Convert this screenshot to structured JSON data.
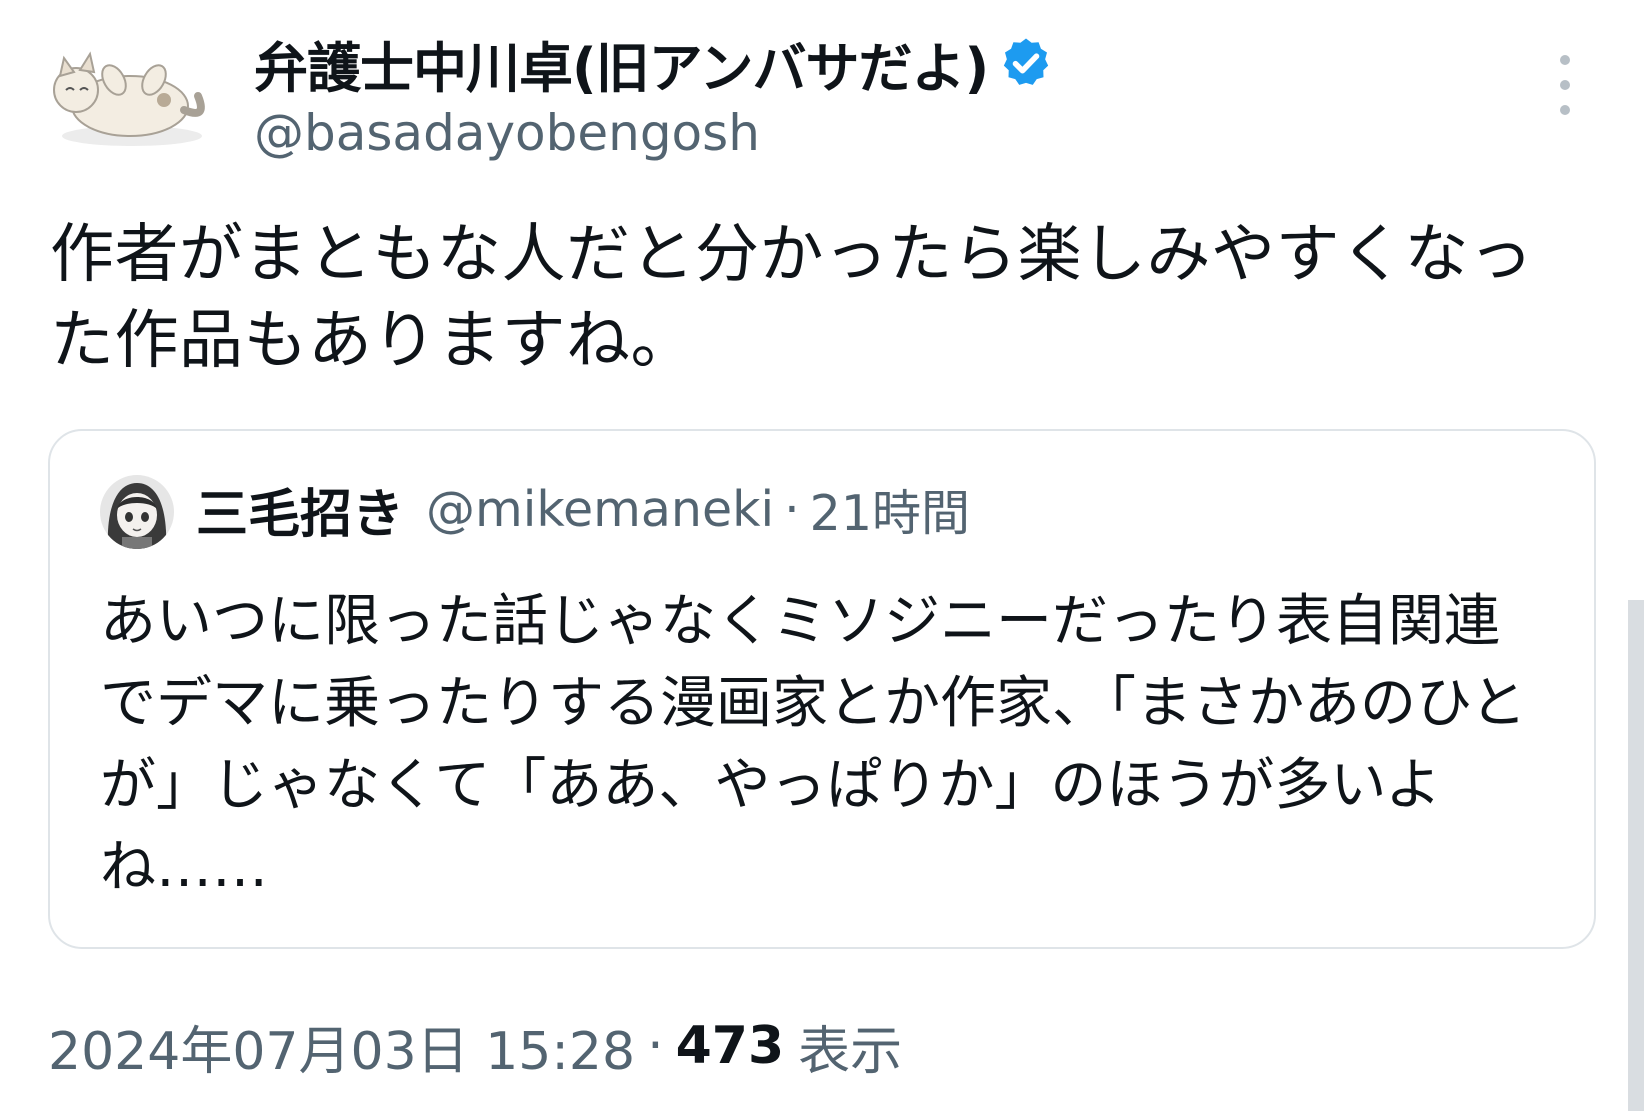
{
  "author": {
    "name": "弁護士中川卓(旧アンバサだよ)",
    "handle": "@basadayobengosh",
    "verified": true,
    "avatar_icon": "sleeping-cat-avatar"
  },
  "tweet": {
    "text": "作者がまともな人だと分かったら楽しみやすくなった作品もありますね。"
  },
  "quoted_tweet": {
    "name": "三毛招き",
    "handle": "@mikemaneki",
    "separator": "·",
    "time": "21時間",
    "text": "あいつに限った話じゃなくミソジニーだったり表自関連でデマに乗ったりする漫画家とか作家、「まさかあのひとが」じゃなくて「ああ、やっぱりか」のほうが多いよね……",
    "avatar_icon": "anime-girl-avatar"
  },
  "meta": {
    "timestamp": "2024年07月03日 15:28",
    "separator": "·",
    "view_count": "473",
    "view_label": "表示"
  },
  "colors": {
    "text_primary": "#0f1419",
    "text_secondary": "#536471",
    "verified_blue": "#1d9bf0",
    "border": "#dfe4e8"
  }
}
